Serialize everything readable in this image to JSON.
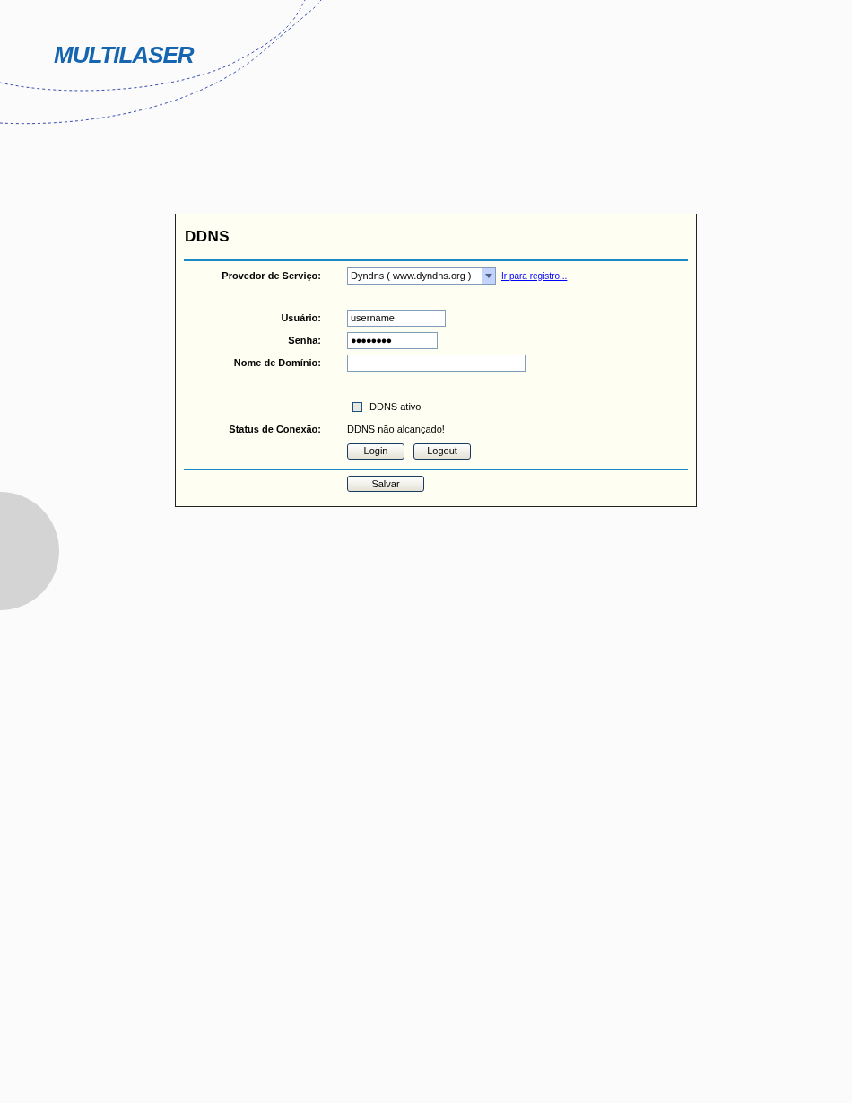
{
  "logo": "MULTILASER",
  "panel": {
    "title": "DDNS",
    "provider": {
      "label": "Provedor de Serviço:",
      "value": "Dyndns ( www.dyndns.org )",
      "link": "Ir para registro..."
    },
    "fields": [
      {
        "label": "Usuário:",
        "value": "username",
        "kind": "short"
      },
      {
        "label": "Senha:",
        "value": "●●●●●●●●",
        "kind": "password"
      },
      {
        "label": "Nome de Domínio:",
        "kind": "long"
      }
    ],
    "ddns_active": {
      "label": "DDNS ativo",
      "checked": false
    },
    "status": {
      "label": "Status de Conexão:",
      "value": "DDNS não alcançado!"
    },
    "buttons": [
      "Login",
      "Logout"
    ],
    "save": "Salvar"
  }
}
